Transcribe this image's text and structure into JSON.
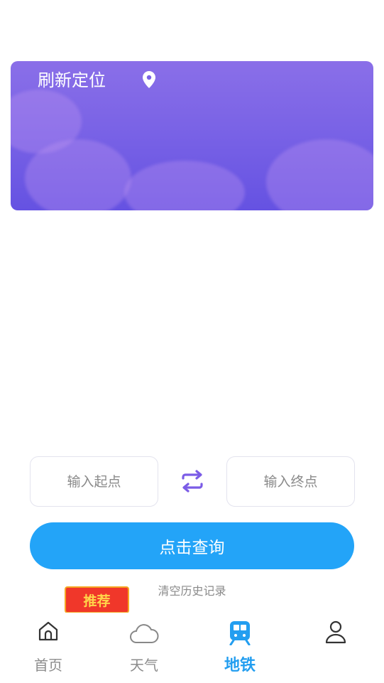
{
  "banner": {
    "refresh_label": "刷新定位"
  },
  "route": {
    "start_placeholder": "输入起点",
    "end_placeholder": "输入终点",
    "query_label": "点击查询",
    "clear_history_label": "清空历史记录"
  },
  "badge": {
    "recommend_label": "推荐"
  },
  "tabbar": {
    "tabs": [
      {
        "label": "首页",
        "icon": "home-icon"
      },
      {
        "label": "天气",
        "icon": "cloud-icon"
      },
      {
        "label": "地铁",
        "icon": "train-icon",
        "active": true
      },
      {
        "label": "",
        "icon": "user-icon"
      }
    ]
  },
  "colors": {
    "accent": "#23a4f8",
    "banner_purple": "#7a63e6",
    "swap_icon": "#7b5ce6",
    "badge_red": "#f0372a"
  }
}
